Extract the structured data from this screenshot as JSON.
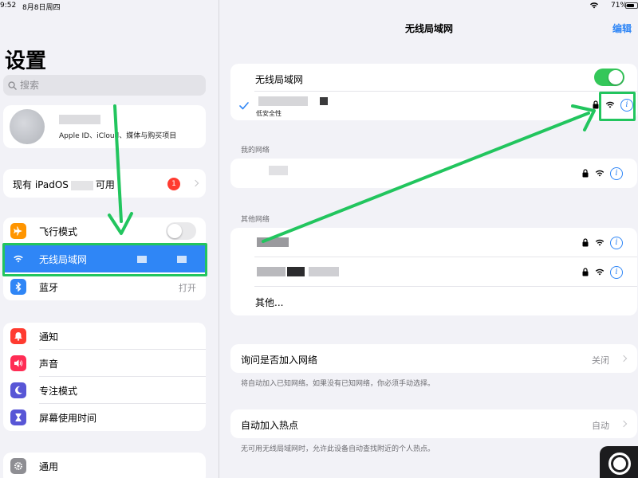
{
  "status_bar": {
    "time": "9:52",
    "date": "8月8日周四",
    "battery": "71%",
    "battery_level": 0.71
  },
  "sidebar": {
    "title": "设置",
    "search_placeholder": "搜索",
    "profile": {
      "subtitle": "Apple ID、iCloud、媒体与购买项目"
    },
    "update": {
      "label_prefix": "现有 iPadOS",
      "label_suffix": "可用",
      "badge": "1"
    },
    "connectivity": [
      {
        "label": "飞行模式",
        "icon": "airplane-icon",
        "color": "#ff9500",
        "toggle": false
      },
      {
        "label": "无线局域网",
        "icon": "wifi-icon",
        "color": "#2f86f6",
        "selected": true
      },
      {
        "label": "蓝牙",
        "icon": "bluetooth-icon",
        "color": "#2f86f6",
        "value": "打开"
      }
    ],
    "notifications": [
      {
        "label": "通知",
        "icon": "bell-icon",
        "color": "#ff3b30"
      },
      {
        "label": "声音",
        "icon": "speaker-icon",
        "color": "#ff2d55"
      },
      {
        "label": "专注模式",
        "icon": "moon-icon",
        "color": "#5856d6"
      },
      {
        "label": "屏幕使用时间",
        "icon": "hourglass-icon",
        "color": "#5856d6"
      }
    ],
    "general": {
      "label": "通用",
      "icon": "gear-icon",
      "color": "#8e8e93"
    }
  },
  "main": {
    "nav_title": "无线局域网",
    "edit_label": "编辑",
    "wifi_toggle_label": "无线局域网",
    "wifi_on": true,
    "connected": {
      "security_note": "低安全性"
    },
    "my_networks_header": "我的网络",
    "other_networks_header": "其他网络",
    "other_label": "其他...",
    "ask_join": {
      "label": "询问是否加入网络",
      "value": "关闭",
      "footnote": "将自动加入已知网络。如果没有已知网络，你必须手动选择。"
    },
    "auto_hotspot": {
      "label": "自动加入热点",
      "value": "自动",
      "footnote": "无可用无线局域网时，允许此设备自动查找附近的个人热点。"
    }
  },
  "colors": {
    "accent": "#2f86f6",
    "toggle_on": "#34c759",
    "highlight": "#22c55e"
  }
}
